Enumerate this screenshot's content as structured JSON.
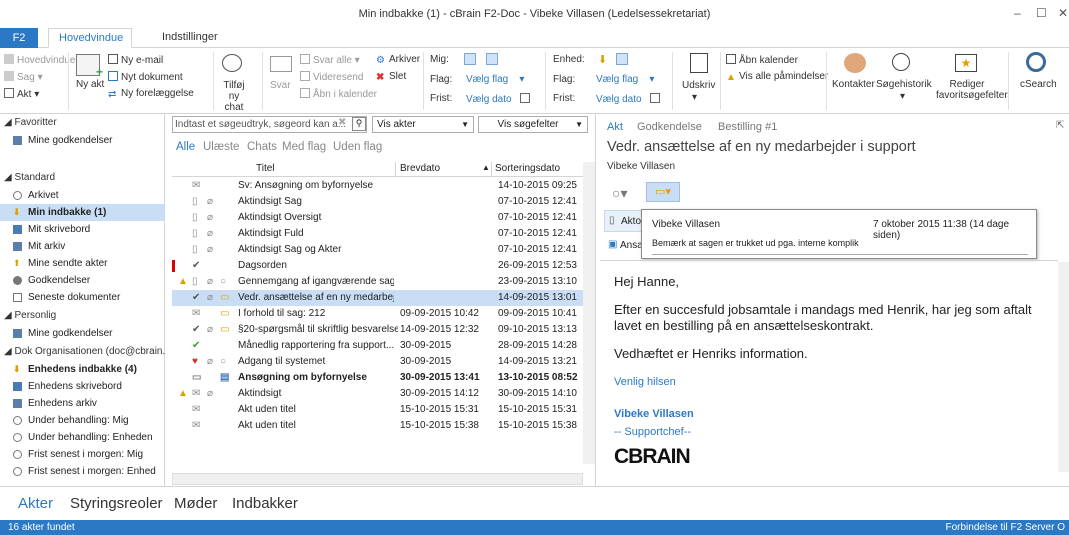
{
  "window": {
    "title": "Min indbakke (1) - cBrain F2-Doc - Vibeke Villasen (Ledelsessekretariat)"
  },
  "tabs": {
    "f2": "F2",
    "main": "Hovedvindue",
    "settings": "Indstillinger"
  },
  "ribbon": {
    "hovedvindue": "Hovedvindue",
    "sag": "Sag",
    "akt": "Akt",
    "ny_akt": "Ny akt",
    "ny_email": "Ny e-mail",
    "nyt_dokument": "Nyt dokument",
    "ny_foreloeggelse": "Ny forelæggelse",
    "tilfoej_chat": "Tilføj ny chat",
    "svar": "Svar",
    "svar_alle": "Svar alle",
    "videresend": "Videresend",
    "aabn_i_kalender": "Åbn i kalender",
    "arkiver": "Arkiver",
    "slet": "Slet",
    "mig": "Mig:",
    "flag_label": "Flag:",
    "frist_label": "Frist:",
    "vaelg_flag": "Vælg flag",
    "vaelg_dato": "Vælg dato",
    "enhed": "Enhed:",
    "udskriv": "Udskriv",
    "aabn_kalender": "Åbn kalender",
    "vis_alle_paamindelser": "Vis alle påmindelser",
    "kontakter": "Kontakter",
    "soegehistorik": "Søgehistorik",
    "rediger_favorit": "Rediger favoritsøgefelter",
    "csearch": "cSearch"
  },
  "sidebar": {
    "favoritter": "Favoritter",
    "fav_items": [
      "Mine godkendelser"
    ],
    "standard": "Standard",
    "standard_items": [
      "Arkivet",
      "Min indbakke (1)",
      "Mit skrivebord",
      "Mit arkiv",
      "Mine sendte akter",
      "Godkendelser",
      "Seneste dokumenter"
    ],
    "personlig": "Personlig",
    "personlig_items": [
      "Mine godkendelser"
    ],
    "dok_org": "Dok Organisationen (doc@cbrain.",
    "dok_items": [
      "Enhedens indbakke (4)",
      "Enhedens skrivebord",
      "Enhedens arkiv",
      "Under behandling: Mig",
      "Under behandling: Enheden",
      "Frist senest i morgen: Mig",
      "Frist senest i morgen: Enhed"
    ]
  },
  "list": {
    "search_placeholder": "Indtast et søgeudtryk, søgeord kan a...",
    "scope": "Vis akter",
    "fields": "Vis søgefelter",
    "filters": [
      "Alle",
      "Ulæste",
      "Chats",
      "Med flag",
      "Uden flag"
    ],
    "headers": {
      "title": "Titel",
      "brevdato": "Brevdato",
      "sortering": "Sorteringsdato"
    },
    "rows": [
      {
        "title": "Sv: Ansøgning om byfornyelse",
        "brevdato": "",
        "sort": "14-10-2015 09:25"
      },
      {
        "title": "Aktindsigt Sag",
        "brevdato": "",
        "sort": "07-10-2015 12:41"
      },
      {
        "title": "Aktindsigt Oversigt",
        "brevdato": "",
        "sort": "07-10-2015 12:41"
      },
      {
        "title": "Aktindsigt Fuld",
        "brevdato": "",
        "sort": "07-10-2015 12:41"
      },
      {
        "title": "Aktindsigt Sag og Akter",
        "brevdato": "",
        "sort": "07-10-2015 12:41"
      },
      {
        "title": "Dagsorden",
        "brevdato": "",
        "sort": "26-09-2015 12:53"
      },
      {
        "title": "Gennemgang af igangværende sag...",
        "brevdato": "",
        "sort": "23-09-2015 13:10"
      },
      {
        "title": "Vedr. ansættelse af en ny medarbej...",
        "brevdato": "",
        "sort": "14-09-2015 13:01"
      },
      {
        "title": "I forhold til sag: 212",
        "brevdato": "09-09-2015 10:42",
        "sort": "09-09-2015 10:41"
      },
      {
        "title": "§20-spørgsmål til skriftlig besvarelse",
        "brevdato": "14-09-2015 12:32",
        "sort": "09-10-2015 13:13"
      },
      {
        "title": "Månedlig rapportering fra support...",
        "brevdato": "30-09-2015",
        "sort": "28-09-2015 14:28"
      },
      {
        "title": "Adgang til systemet",
        "brevdato": "30-09-2015",
        "sort": "14-09-2015 13:21"
      },
      {
        "title": "Ansøgning om byfornyelse",
        "brevdato": "30-09-2015 13:41",
        "sort": "13-10-2015 08:52"
      },
      {
        "title": "Aktindsigt",
        "brevdato": "30-09-2015 14:12",
        "sort": "30-09-2015 14:10"
      },
      {
        "title": "Akt uden titel",
        "brevdato": "15-10-2015 15:31",
        "sort": "15-10-2015 15:31"
      },
      {
        "title": "Akt uden titel",
        "brevdato": "15-10-2015 15:38",
        "sort": "15-10-2015 15:38"
      }
    ]
  },
  "preview": {
    "tabs": [
      "Akt",
      "Godkendelse",
      "Bestilling #1"
    ],
    "subject": "Vedr. ansættelse af en ny medarbejder i support",
    "from": "Vibeke Villasen",
    "attach1": "Akto",
    "attach2": "Ansa",
    "tooltip_name": "Vibeke Villasen",
    "tooltip_date": "7 oktober 2015 11:38 (14 dage siden)",
    "tooltip_text": "Bemærk at sagen er trukket ud pga. interne komplik",
    "greeting": "Hej Hanne,",
    "para1": "Efter en succesfuld jobsamtale i mandags med Henrik, har jeg som aftalt lavet en bestilling på en ansættelseskontrakt.",
    "para2": "Vedhæftet er Henriks information.",
    "regards": "Venlig hilsen",
    "sig_name": "Vibeke Villasen",
    "sig_title": "-- Supportchef--",
    "logo": "CBRAIN"
  },
  "bottomnav": [
    "Akter",
    "Styringsreoler",
    "Møder",
    "Indbakker"
  ],
  "status": {
    "left": "16 akter fundet",
    "right": "Forbindelse til F2 Server O"
  },
  "colors": {
    "accent": "#2b79c5",
    "selected": "#c9def5"
  }
}
